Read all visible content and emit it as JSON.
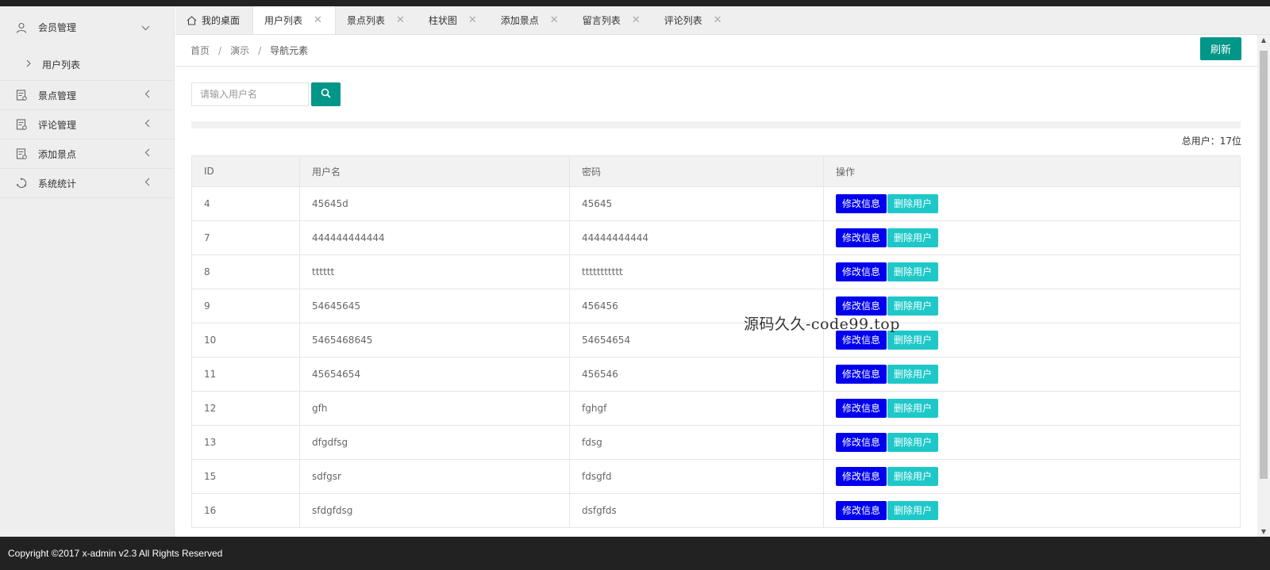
{
  "sidebar": {
    "items": [
      {
        "label": "会员管理",
        "icon": "user-icon",
        "arrow": "chevron-down"
      },
      {
        "label": "景点管理",
        "icon": "document-icon",
        "arrow": "chevron-left"
      },
      {
        "label": "评论管理",
        "icon": "document-icon",
        "arrow": "chevron-left"
      },
      {
        "label": "添加景点",
        "icon": "document-icon",
        "arrow": "chevron-left"
      },
      {
        "label": "系统统计",
        "icon": "stats-icon",
        "arrow": "chevron-left"
      }
    ],
    "sub_items": [
      {
        "label": "用户列表"
      }
    ]
  },
  "tabs": [
    {
      "label": "我的桌面",
      "icon": "home-icon"
    },
    {
      "label": "用户列表",
      "active": true
    },
    {
      "label": "景点列表"
    },
    {
      "label": "柱状图"
    },
    {
      "label": "添加景点"
    },
    {
      "label": "留言列表"
    },
    {
      "label": "评论列表"
    }
  ],
  "breadcrumb": {
    "items": [
      "首页",
      "演示",
      "导航元素"
    ],
    "separator": "/"
  },
  "refresh_label": "刷新",
  "search": {
    "placeholder": "请输入用户名",
    "value": ""
  },
  "total_text": "总用户：17位",
  "table": {
    "headers": [
      "ID",
      "用户名",
      "密码",
      "操作"
    ],
    "edit_label": "修改信息",
    "delete_label": "删除用户",
    "rows": [
      [
        "4",
        "45645d",
        "45645"
      ],
      [
        "7",
        "444444444444",
        "44444444444"
      ],
      [
        "8",
        "tttttt",
        "ttttttttttt"
      ],
      [
        "9",
        "54645645",
        "456456"
      ],
      [
        "10",
        "5465468645",
        "54654654"
      ],
      [
        "11",
        "45654654",
        "456546"
      ],
      [
        "12",
        "gfh",
        "fghgf"
      ],
      [
        "13",
        "dfgdfsg",
        "fdsg"
      ],
      [
        "15",
        "sdfgsr",
        "fdsgfd"
      ],
      [
        "16",
        "sfdgfdsg",
        "dsfgfds"
      ]
    ]
  },
  "watermark": "源码久久-code99.top",
  "footer": "Copyright ©2017 x-admin v2.3 All Rights Reserved",
  "colors": {
    "primary": "#009688",
    "edit": "#0000ee",
    "delete": "#1ec8c8",
    "footer_bg": "#222222"
  }
}
